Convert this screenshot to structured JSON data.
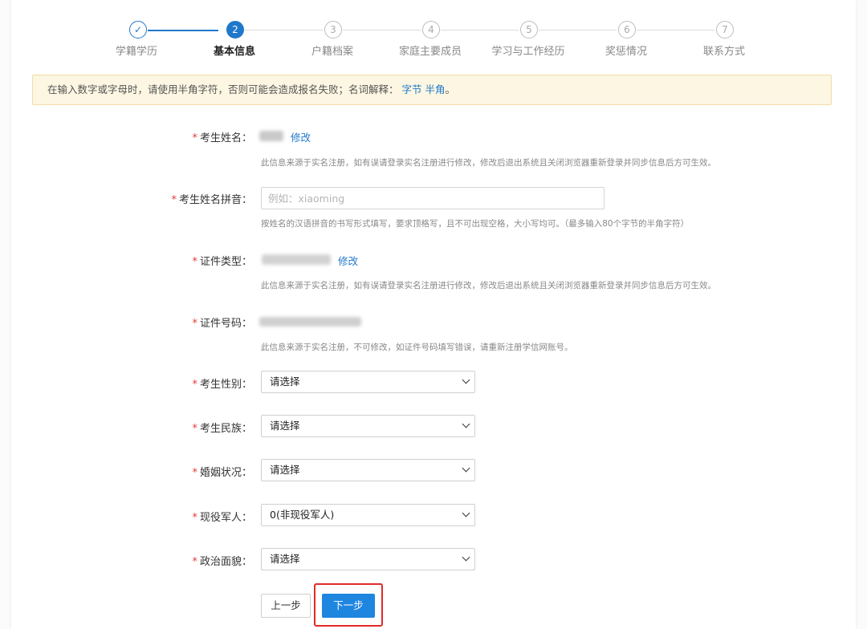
{
  "steps": [
    {
      "num": "✓",
      "label": "学籍学历",
      "state": "done"
    },
    {
      "num": "2",
      "label": "基本信息",
      "state": "active"
    },
    {
      "num": "3",
      "label": "户籍档案",
      "state": "todo"
    },
    {
      "num": "4",
      "label": "家庭主要成员",
      "state": "todo"
    },
    {
      "num": "5",
      "label": "学习与工作经历",
      "state": "todo"
    },
    {
      "num": "6",
      "label": "奖惩情况",
      "state": "todo"
    },
    {
      "num": "7",
      "label": "联系方式",
      "state": "todo"
    }
  ],
  "notice": {
    "text": "在输入数字或字母时，请使用半角字符，否则可能会造成报名失败；名词解释：",
    "link1": "字节",
    "link2": "半角",
    "end": "。"
  },
  "form": {
    "required_mark": "*",
    "name": {
      "label": "考生姓名：",
      "edit": "修改",
      "hint": "此信息来源于实名注册，如有误请登录实名注册进行修改，修改后退出系统且关闭浏览器重新登录并同步信息后方可生效。"
    },
    "pinyin": {
      "label": "考生姓名拼音：",
      "placeholder": "例如：xiaoming",
      "hint": "按姓名的汉语拼音的书写形式填写，要求顶格写，且不可出现空格，大小写均可。（最多输入80个字节的半角字符）"
    },
    "id_type": {
      "label": "证件类型：",
      "edit": "修改",
      "hint": "此信息来源于实名注册，如有误请登录实名注册进行修改，修改后退出系统且关闭浏览器重新登录并同步信息后方可生效。"
    },
    "id_number": {
      "label": "证件号码：",
      "hint": "此信息来源于实名注册，不可修改，如证件号码填写错误，请重新注册学信网账号。"
    },
    "gender": {
      "label": "考生性别：",
      "value": "请选择"
    },
    "ethnicity": {
      "label": "考生民族：",
      "value": "请选择"
    },
    "marital": {
      "label": "婚姻状况：",
      "value": "请选择"
    },
    "military": {
      "label": "现役军人：",
      "value": "0(非现役军人)"
    },
    "political": {
      "label": "政治面貌：",
      "value": "请选择"
    }
  },
  "buttons": {
    "prev": "上一步",
    "next": "下一步"
  },
  "colors": {
    "accent": "#1f78c9",
    "required": "#e23b3b",
    "notice_bg": "#fcf6e2",
    "highlight": "#e02a2a"
  }
}
